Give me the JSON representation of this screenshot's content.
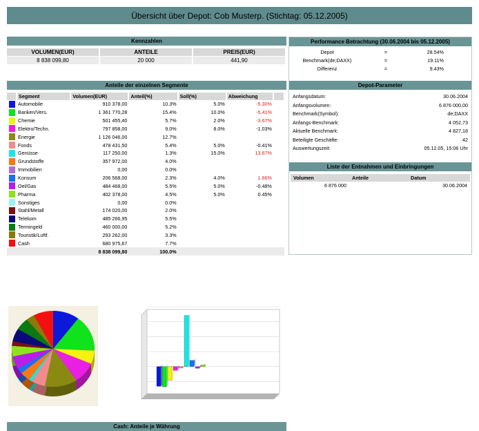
{
  "title": "Übersicht über Depot: Cob Musterp. (Stichtag: 05.12.2005)",
  "kennzahlen": {
    "header": "Kennzahlen",
    "columns": [
      "VOLUMEN(EUR)",
      "ANTEILE",
      "PREIS(EUR)"
    ],
    "values": [
      "8 838 099,80",
      "20 000",
      "441,90"
    ]
  },
  "segments": {
    "header": "Anteile der einzelnen Segmente",
    "columns": [
      "Segment",
      "Volumen(EUR)",
      "Anteil(%)",
      "Soll(%)",
      "Abweichung"
    ],
    "rows": [
      {
        "color": "#0a1ad8",
        "name": "Automobile",
        "volumen": "910 378,00",
        "anteil": "10.3%",
        "soll": "5.0%",
        "abw": "-5.30%",
        "abw_red": true
      },
      {
        "color": "#10e21c",
        "name": "Banken/Vers.",
        "volumen": "1 361 770,28",
        "anteil": "15.4%",
        "soll": "10.0%",
        "abw": "-5.41%",
        "abw_red": true
      },
      {
        "color": "#f4f20e",
        "name": "Chemie",
        "volumen": "501 455,40",
        "anteil": "5.7%",
        "soll": "2.0%",
        "abw": "-3.67%",
        "abw_red": true
      },
      {
        "color": "#e91fe4",
        "name": "Elektro/Techn.",
        "volumen": "797 858,00",
        "anteil": "9.0%",
        "soll": "8.0%",
        "abw": "-1.03%",
        "abw_red": false
      },
      {
        "color": "#8a8a12",
        "name": "Energie",
        "volumen": "1 126 046,00",
        "anteil": "12.7%",
        "soll": "",
        "abw": "",
        "abw_red": false
      },
      {
        "color": "#f28c8c",
        "name": "Fonds",
        "volumen": "478 431,50",
        "anteil": "5.4%",
        "soll": "5.0%",
        "abw": "-0.41%",
        "abw_red": false
      },
      {
        "color": "#17e8e6",
        "name": "Genüsse",
        "volumen": "117 250,00",
        "anteil": "1.3%",
        "soll": "15.0%",
        "abw": "13.67%",
        "abw_red": true
      },
      {
        "color": "#f57a16",
        "name": "Grundstoffe",
        "volumen": "357 972,00",
        "anteil": "4.0%",
        "soll": "",
        "abw": "",
        "abw_red": false
      },
      {
        "color": "#b26bd6",
        "name": "Immobilien",
        "volumen": "0,00",
        "anteil": "0.0%",
        "soll": "",
        "abw": "",
        "abw_red": false
      },
      {
        "color": "#1a6ff2",
        "name": "Konsum",
        "volumen": "206 568,00",
        "anteil": "2.3%",
        "soll": "4.0%",
        "abw": "1.66%",
        "abw_red": true
      },
      {
        "color": "#b81ee8",
        "name": "Oel/Gas",
        "volumen": "484 468,00",
        "anteil": "5.5%",
        "soll": "5.0%",
        "abw": "-0.48%",
        "abw_red": false
      },
      {
        "color": "#8fe21c",
        "name": "Pharma",
        "volumen": "402 378,00",
        "anteil": "4.5%",
        "soll": "5.0%",
        "abw": "0.45%",
        "abw_red": false
      },
      {
        "color": "#9af2f4",
        "name": "Sonstiges",
        "volumen": "0,00",
        "anteil": "0.0%",
        "soll": "",
        "abw": "",
        "abw_red": false
      },
      {
        "color": "#7a1010",
        "name": "Stahl/Metall",
        "volumen": "174 020,00",
        "anteil": "2.0%",
        "soll": "",
        "abw": "",
        "abw_red": false
      },
      {
        "color": "#0a0a7a",
        "name": "Telekom",
        "volumen": "485 266,95",
        "anteil": "5.5%",
        "soll": "",
        "abw": "",
        "abw_red": false
      },
      {
        "color": "#0a7a12",
        "name": "Termingeld",
        "volumen": "460 000,00",
        "anteil": "5.2%",
        "soll": "",
        "abw": "",
        "abw_red": false
      },
      {
        "color": "#8a7a0a",
        "name": "Touristik/Luftf.",
        "volumen": "293 262,00",
        "anteil": "3.3%",
        "soll": "",
        "abw": "",
        "abw_red": false
      },
      {
        "color": "#f41010",
        "name": "Cash",
        "volumen": "680 975,67",
        "anteil": "7.7%",
        "soll": "",
        "abw": "",
        "abw_red": false
      }
    ],
    "total_volumen": "8 838 099,80",
    "total_anteil": "100.0%"
  },
  "performance": {
    "header": "Performance Betrachtung (30.06.2004 bis 05.12.2005)",
    "rows": [
      {
        "label": "Depot",
        "eq": "=",
        "value": "28.54%"
      },
      {
        "label": "Benchmark(de;DAXX)",
        "eq": "=",
        "value": "19.11%"
      },
      {
        "label": "Differenz",
        "eq": "=",
        "value": "9.43%"
      }
    ]
  },
  "parameter": {
    "header": "Depot-Parameter",
    "rows": [
      {
        "label": "Anfangsdatum:",
        "value": "30.06.2004"
      },
      {
        "label": "Anfangsvolumen:",
        "value": "6 876 000,00"
      },
      {
        "label": "Benchmark(Symbol):",
        "value": "de;DAXX"
      },
      {
        "label": "Anfangs-Benchmark:",
        "value": "4 052,73"
      },
      {
        "label": "Aktuelle Benchmark:",
        "value": "4 827,18"
      },
      {
        "label": "Beteiligte Geschäfte:",
        "value": "42"
      },
      {
        "label": "Auswertungszeit:",
        "value": "05.12.05, 15:06 Uhr"
      }
    ]
  },
  "entnahmen": {
    "header": "Liste der Entnahmen und Einbringungen",
    "columns": [
      "Volumen",
      "Anteile",
      "Datum"
    ],
    "rows": [
      {
        "volumen": "6 876 000",
        "anteile": "",
        "datum": "30.06.2004"
      }
    ]
  },
  "cash_header": "Cash: Anteile je Währung",
  "chart_data": [
    {
      "type": "pie",
      "title": "",
      "categories": [
        "Automobile",
        "Banken/Vers.",
        "Chemie",
        "Elektro/Techn.",
        "Energie",
        "Fonds",
        "Genüsse",
        "Grundstoffe",
        "Immobilien",
        "Konsum",
        "Oel/Gas",
        "Pharma",
        "Sonstiges",
        "Stahl/Metall",
        "Telekom",
        "Termingeld",
        "Touristik/Luftf.",
        "Cash"
      ],
      "values": [
        10.3,
        15.4,
        5.7,
        9.0,
        12.7,
        5.4,
        1.3,
        4.0,
        0.0,
        2.3,
        5.5,
        4.5,
        0.0,
        2.0,
        5.5,
        5.2,
        3.3,
        7.7
      ],
      "colors": [
        "#0a1ad8",
        "#10e21c",
        "#f4f20e",
        "#e91fe4",
        "#8a8a12",
        "#f28c8c",
        "#17e8e6",
        "#f57a16",
        "#b26bd6",
        "#1a6ff2",
        "#b81ee8",
        "#8fe21c",
        "#9af2f4",
        "#7a1010",
        "#0a0a7a",
        "#0a7a12",
        "#8a7a0a",
        "#f41010"
      ]
    },
    {
      "type": "bar",
      "title": "",
      "xlabel": "",
      "ylabel": "",
      "categories": [
        "Automobile",
        "Banken/Vers.",
        "Chemie",
        "Elektro/Techn.",
        "Fonds",
        "Genüsse",
        "Konsum",
        "Oel/Gas",
        "Pharma"
      ],
      "values": [
        -5.3,
        -5.41,
        -3.67,
        -1.03,
        -0.41,
        13.67,
        1.66,
        -0.48,
        0.45
      ],
      "colors": [
        "#0a1ad8",
        "#10e21c",
        "#f4f20e",
        "#e91fe4",
        "#f28c8c",
        "#17e8e6",
        "#1a6ff2",
        "#b81ee8",
        "#8fe21c"
      ],
      "ylim": [
        -8,
        16
      ],
      "grid": true
    }
  ]
}
